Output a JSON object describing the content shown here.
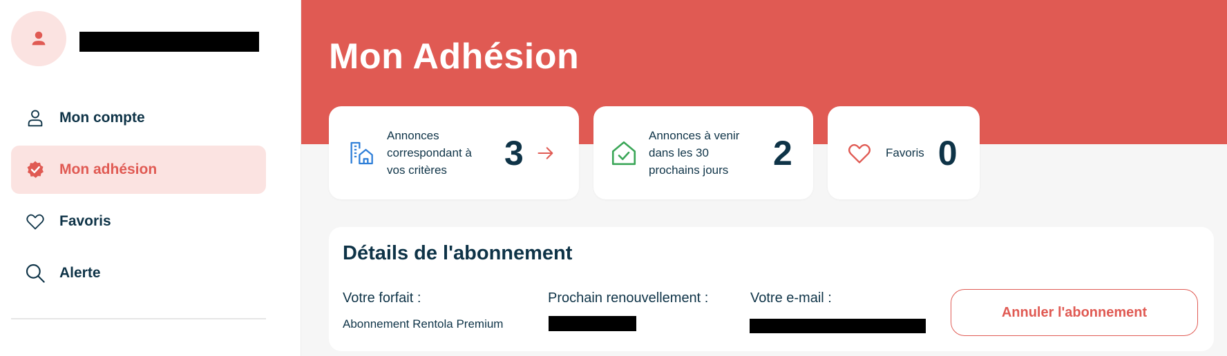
{
  "sidebar": {
    "avatar_icon": "user-icon",
    "items": [
      {
        "label": "Mon compte",
        "icon": "user-outline-icon",
        "active": false
      },
      {
        "label": "Mon adhésion",
        "icon": "badge-check-icon",
        "active": true
      },
      {
        "label": "Favoris",
        "icon": "heart-outline-icon",
        "active": false
      },
      {
        "label": "Alerte",
        "icon": "search-icon",
        "active": false
      }
    ]
  },
  "page": {
    "title": "Mon Adhésion"
  },
  "stats": [
    {
      "text": "Annonces correspondant à vos critères",
      "count": "3",
      "icon": "buildings-icon",
      "icon_color": "#2f7fd8",
      "has_arrow": true
    },
    {
      "text": "Annonces à venir dans les 30 prochains jours",
      "count": "2",
      "icon": "house-check-icon",
      "icon_color": "#3aa657",
      "has_arrow": false
    },
    {
      "text": "Favoris",
      "count": "0",
      "icon": "heart-outline-icon",
      "icon_color": "#e05a53",
      "has_arrow": false
    }
  ],
  "subscription": {
    "title": "Détails de l'abonnement",
    "plan_label": "Votre forfait :",
    "plan_value": "Abonnement Rentola Premium",
    "renewal_label": "Prochain renouvellement :",
    "email_label": "Votre e-mail :",
    "cancel_label": "Annuler l'abonnement"
  },
  "colors": {
    "accent": "#e05a53",
    "accent_light": "#fbe3e1",
    "text": "#0e3347"
  }
}
